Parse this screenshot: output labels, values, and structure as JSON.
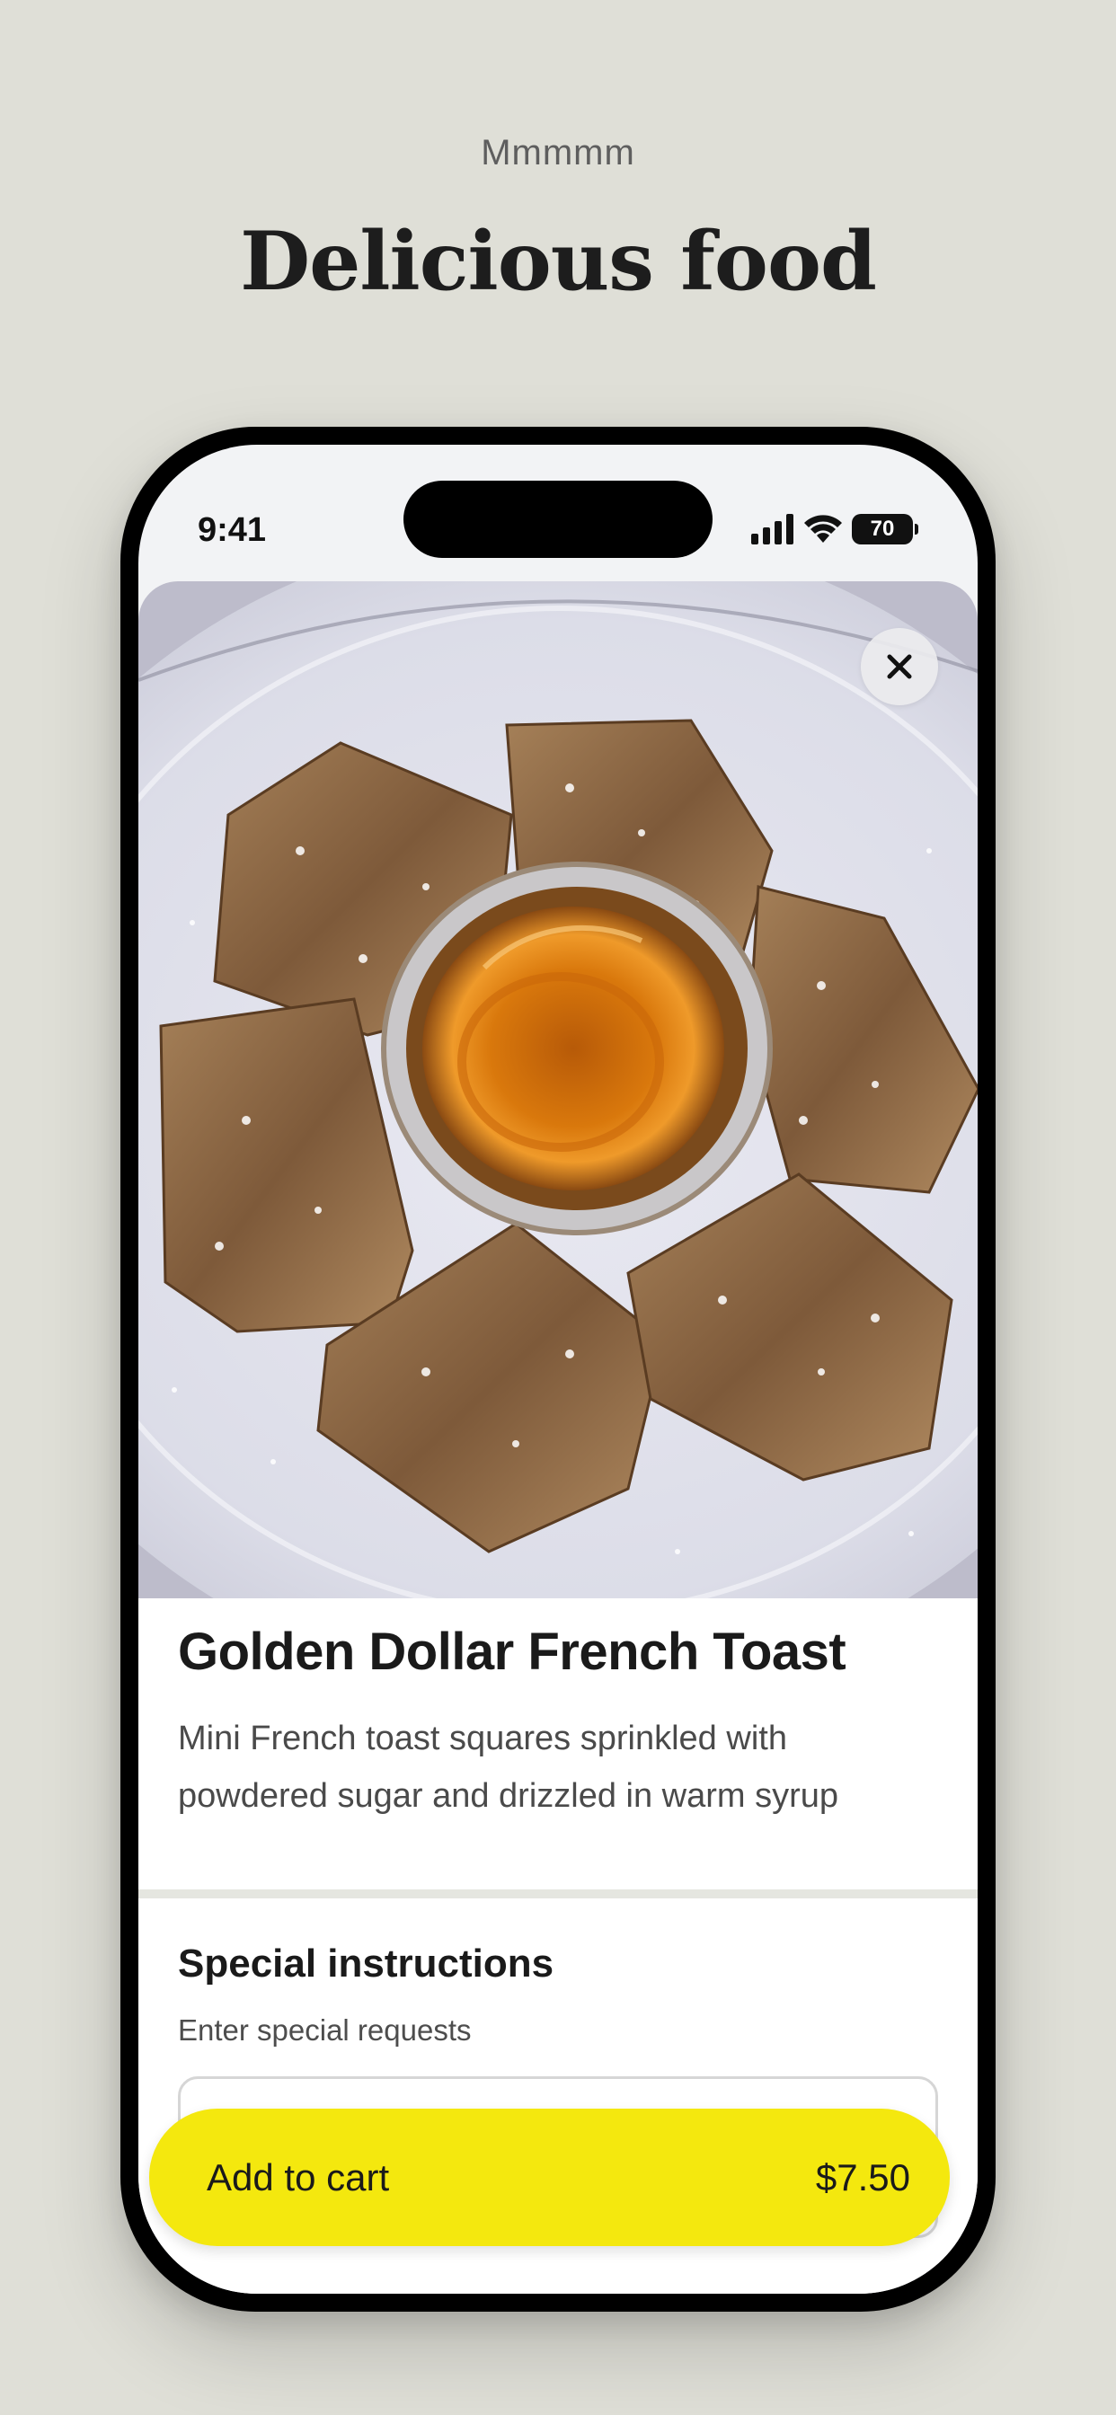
{
  "header": {
    "eyebrow": "Mmmmm",
    "headline": "Delicious food"
  },
  "status_bar": {
    "time": "9:41",
    "battery": "70",
    "icons": [
      "signal-icon",
      "wifi-icon",
      "battery-icon"
    ]
  },
  "item": {
    "photo": "french-toast-photo",
    "title": "Golden Dollar French Toast",
    "description": "Mini French toast squares sprinkled with powdered sugar and drizzled in warm syrup"
  },
  "close_icon": "close-icon",
  "instructions": {
    "title": "Special instructions",
    "subtitle": "Enter special requests",
    "value": ""
  },
  "cart": {
    "label": "Add to cart",
    "price": "$7.50"
  },
  "colors": {
    "background": "#dfdfd7",
    "accent": "#f4e80e",
    "text": "#1a1a1a"
  }
}
